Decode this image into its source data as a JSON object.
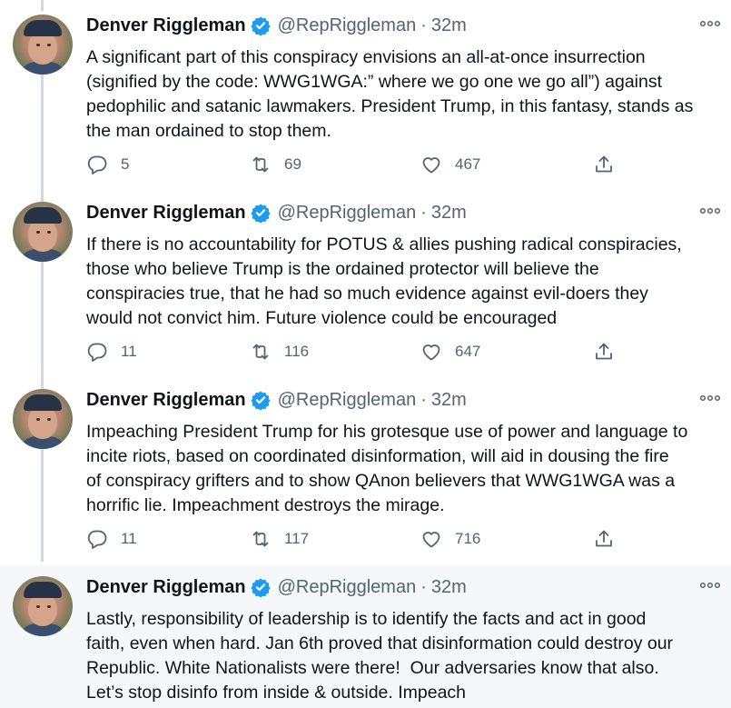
{
  "tweets": [
    {
      "name": "Denver Riggleman",
      "handle": "@RepRiggleman",
      "separator": "·",
      "time": "32m",
      "text": "A significant part of this conspiracy envisions an all-at-once insurrection\n(signified by the code: WWG1WGA:” where we go one we go all”) against\npedophilic and satanic lawmakers. President Trump, in this fantasy, stands as\nthe man ordained to stop them.",
      "replies": "5",
      "retweets": "69",
      "likes": "467"
    },
    {
      "name": "Denver Riggleman",
      "handle": "@RepRiggleman",
      "separator": "·",
      "time": "32m",
      "text": "If there is no accountability for POTUS & allies pushing radical conspiracies,\nthose who believe Trump is the ordained protector will believe the\nconspiracies true, that he had so much evidence against evil-doers they\nwould not convict him. Future violence could be encouraged",
      "replies": "11",
      "retweets": "116",
      "likes": "647"
    },
    {
      "name": "Denver Riggleman",
      "handle": "@RepRiggleman",
      "separator": "·",
      "time": "32m",
      "text": "Impeaching President Trump for his grotesque use of power and language to\nincite riots, based on coordinated disinformation, will aid in dousing the fire\nof conspiracy grifters and to show QAnon believers that WWG1WGA was a\nhorrific lie. Impeachment destroys the mirage.",
      "replies": "11",
      "retweets": "117",
      "likes": "716"
    },
    {
      "name": "Denver Riggleman",
      "handle": "@RepRiggleman",
      "separator": "·",
      "time": "32m",
      "text": "Lastly, responsibility of leadership is to identify the facts and act in good\nfaith, even when hard. Jan 6th proved that disinformation could destroy our\nRepublic. White Nationalists were there!  Our adversaries know that also.\nLet’s stop disinfo from inside & outside. Impeach"
    }
  ],
  "icons": {
    "verified": "verified-badge-icon",
    "more": "more-horizontal-icon",
    "reply": "reply-icon",
    "retweet": "retweet-icon",
    "like": "heart-icon",
    "share": "share-icon"
  },
  "colors": {
    "verified": "#1d9bf0",
    "muted": "#536471",
    "thread_line": "#cfd9de",
    "highlight_bg": "#f5f8fa"
  }
}
